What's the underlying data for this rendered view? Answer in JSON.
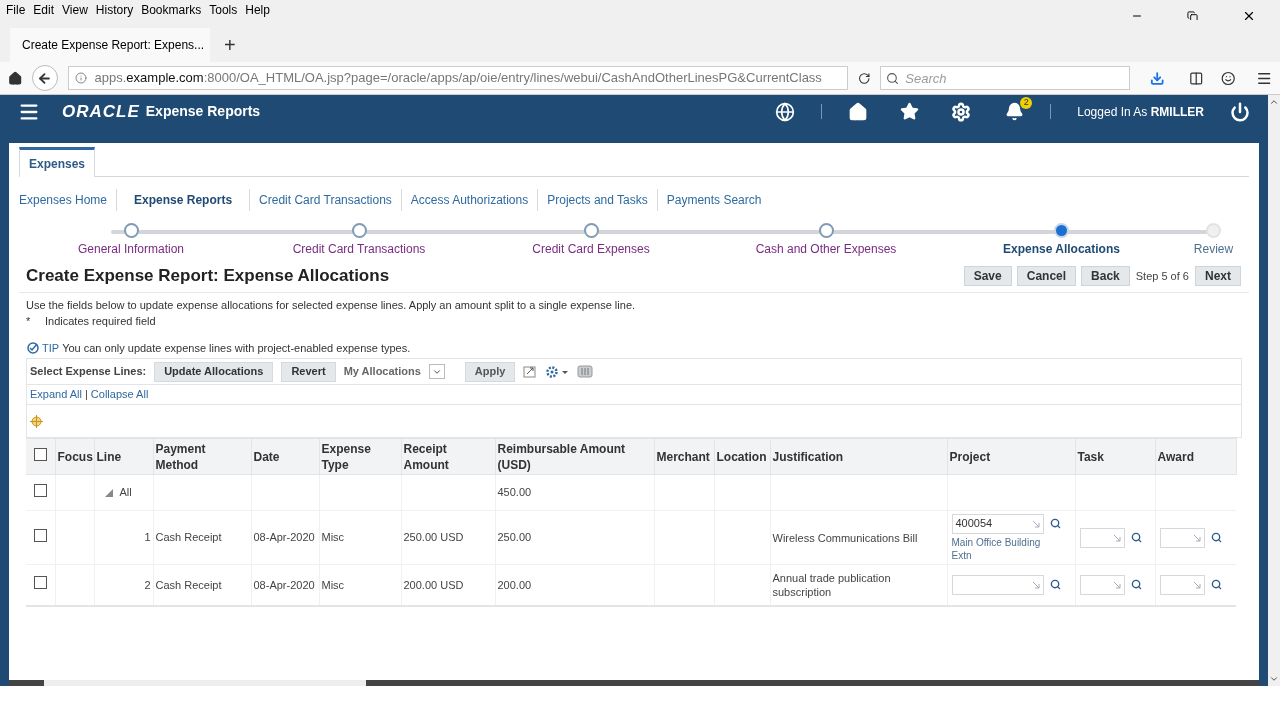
{
  "browser": {
    "menu": [
      "File",
      "Edit",
      "View",
      "History",
      "Bookmarks",
      "Tools",
      "Help"
    ],
    "tab_title": "Create Expense Report: Expens...",
    "new_tab": "+",
    "url": {
      "before": "apps.",
      "domain": "example.com",
      "after": ":8000/OA_HTML/OA.jsp?page=/oracle/apps/ap/oie/entry/lines/webui/CashAndOtherLinesPG&CurrentClass"
    },
    "search": {
      "placeholder": "Search"
    }
  },
  "header": {
    "brand": "ORACLE",
    "title": "Expense Reports",
    "notification_count": "2",
    "logged_in_label": "Logged In As",
    "user": "RMILLER"
  },
  "tabs": [
    {
      "label": "Expenses",
      "selected": true
    }
  ],
  "subnav": [
    {
      "label": "Expenses Home",
      "selected": false
    },
    {
      "label": "Expense Reports",
      "selected": true
    },
    {
      "label": "Credit Card Transactions",
      "selected": false
    },
    {
      "label": "Access Authorizations",
      "selected": false
    },
    {
      "label": "Projects and Tasks",
      "selected": false
    },
    {
      "label": "Payments Search",
      "selected": false
    }
  ],
  "train": [
    {
      "label": "General Information",
      "visited": true,
      "selected": false
    },
    {
      "label": "Credit Card Transactions",
      "visited": true,
      "selected": false
    },
    {
      "label": "Credit Card Expenses",
      "visited": true,
      "selected": false
    },
    {
      "label": "Cash and Other Expenses",
      "visited": true,
      "selected": false
    },
    {
      "label": "Expense Allocations",
      "visited": true,
      "selected": true
    },
    {
      "label": "Review",
      "visited": false,
      "selected": false
    }
  ],
  "page": {
    "title": "Create Expense Report: Expense Allocations",
    "buttons": [
      "Save",
      "Cancel",
      "Back"
    ],
    "step": "Step 5 of 6",
    "next": "Next",
    "instructions": "Use the fields below to update expense allocations for selected expense lines. Apply an amount split to a single expense line.",
    "required_mark": "*",
    "required_text": "Indicates required field",
    "tip_label": "TIP",
    "tip_text": "You can only update expense lines with project-enabled expense types."
  },
  "toolbar": {
    "label": "Select Expense Lines:",
    "buttons": [
      "Update Allocations",
      "Revert"
    ],
    "view_label": "My Allocations",
    "apply": "Apply",
    "expand_all": "Expand All",
    "separator": "|",
    "collapse_all": "Collapse All"
  },
  "table": {
    "select_all_checked": false,
    "columns": [
      "Focus",
      "Line",
      "Payment Method",
      "Date",
      "Expense Type",
      "Receipt Amount",
      "Reimbursable Amount (USD)",
      "Merchant",
      "Location",
      "Justification",
      "Project",
      "Task",
      "Award"
    ],
    "rows": [
      {
        "kind": "total",
        "checked": false,
        "expanded": true,
        "label": "All",
        "reimbursable": "450.00"
      },
      {
        "kind": "line",
        "checked": false,
        "line": "1",
        "payment_method": "Cash Receipt",
        "date": "08-Apr-2020",
        "expense_type": "Misc",
        "receipt_amount": "250.00 USD",
        "reimbursable": "250.00",
        "justification": "Wireless Communications Bill",
        "project": {
          "value": "400054",
          "description": "Main Office Building Extn"
        }
      },
      {
        "kind": "line",
        "checked": false,
        "line": "2",
        "payment_method": "Cash Receipt",
        "date": "08-Apr-2020",
        "expense_type": "Misc",
        "receipt_amount": "200.00 USD",
        "reimbursable": "200.00",
        "justification": "Annual trade publication subscription"
      }
    ]
  }
}
